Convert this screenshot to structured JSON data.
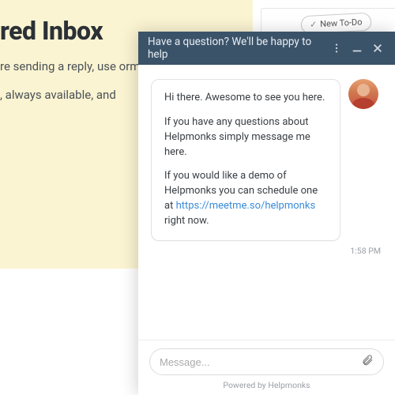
{
  "page": {
    "title_fragment": "red Inbox",
    "para1": "re sending a reply, use orm of a task.",
    "para2": ", always available, and"
  },
  "todo_button": {
    "label": "New To-Do"
  },
  "chat": {
    "header": "Have a question? We'll be happy to help",
    "greeting": "Hi there. Awesome to see you here.",
    "line2": "If you have any questions about Helpmonks simply message me here.",
    "line3a": "If you would like a demo of Helpmonks you can schedule one at ",
    "demo_link": "https://meetme.so/helpmonks",
    "line3b": " right now.",
    "timestamp": "1:58 PM",
    "input_placeholder": "Message...",
    "powered": "Powered by Helpmonks"
  }
}
